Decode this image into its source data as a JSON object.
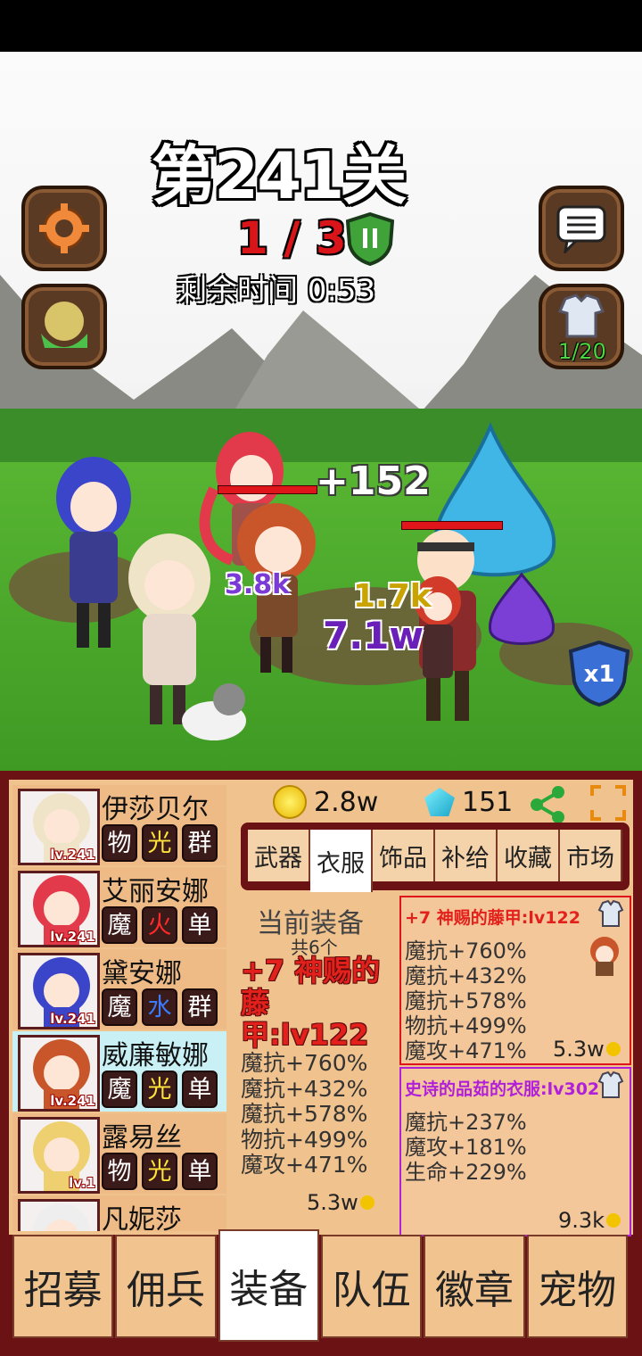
{
  "stage": {
    "title": "第241关",
    "wave": "1 / 3",
    "timer": "剩余时间 0:53",
    "armor_count": "1/20",
    "speed": "x1"
  },
  "battle": {
    "heal_popup": "+152",
    "damage_popups": [
      "3.8k",
      "1.7k",
      "7.1w"
    ]
  },
  "heroes": [
    {
      "name": "伊莎贝尔",
      "level": "lv.241",
      "tags": [
        "物",
        "光",
        "群"
      ],
      "tag_styles": [
        "phy",
        "light",
        "grp"
      ],
      "selected": false
    },
    {
      "name": "艾丽安娜",
      "level": "lv.241",
      "tags": [
        "魔",
        "火",
        "单"
      ],
      "tag_styles": [
        "mag",
        "fire",
        "one"
      ],
      "selected": false
    },
    {
      "name": "黛安娜",
      "level": "lv.241",
      "tags": [
        "魔",
        "水",
        "群"
      ],
      "tag_styles": [
        "mag",
        "water",
        "grp"
      ],
      "selected": false
    },
    {
      "name": "威廉敏娜",
      "level": "lv.241",
      "tags": [
        "魔",
        "光",
        "单"
      ],
      "tag_styles": [
        "mag",
        "light",
        "one"
      ],
      "selected": true
    },
    {
      "name": "露易丝",
      "level": "lv.1",
      "tags": [
        "物",
        "光",
        "单"
      ],
      "tag_styles": [
        "phy",
        "light",
        "one"
      ],
      "selected": false
    },
    {
      "name": "凡妮莎",
      "level": "",
      "tags": [],
      "tag_styles": [],
      "selected": false
    }
  ],
  "currency": {
    "gold": "2.8w",
    "gems": "151"
  },
  "equip_tabs": [
    "武器",
    "衣服",
    "饰品",
    "补给",
    "收藏",
    "市场"
  ],
  "current": {
    "title": "当前装备",
    "count": "共6个",
    "name": "+7 神赐的藤甲:lv122",
    "stats": [
      "魔抗+760%",
      "魔抗+432%",
      "魔抗+578%",
      "物抗+499%",
      "魔攻+471%"
    ],
    "price": "5.3w"
  },
  "cards": [
    {
      "title": "+7 神赐的藤甲:lv122",
      "title_color": "#e3211c",
      "border": "#e0141b",
      "stats": [
        "魔抗+760%",
        "魔抗+432%",
        "魔抗+578%",
        "物抗+499%",
        "魔攻+471%"
      ],
      "price": "5.3w"
    },
    {
      "title": "史诗的品茹的衣服:lv302",
      "title_color": "#b020d8",
      "border": "#b020d8",
      "stats": [
        "魔抗+237%",
        "魔攻+181%",
        "生命+229%"
      ],
      "price": "9.3k"
    }
  ],
  "nav": [
    "招募",
    "佣兵",
    "装备",
    "队伍",
    "徽章",
    "宠物"
  ],
  "colors": {
    "panel": "#6a1214",
    "panel_bg": "#f0c28d",
    "selected_hero": "#c8f0f5",
    "legendary": "#e3211c",
    "epic": "#b020d8"
  }
}
